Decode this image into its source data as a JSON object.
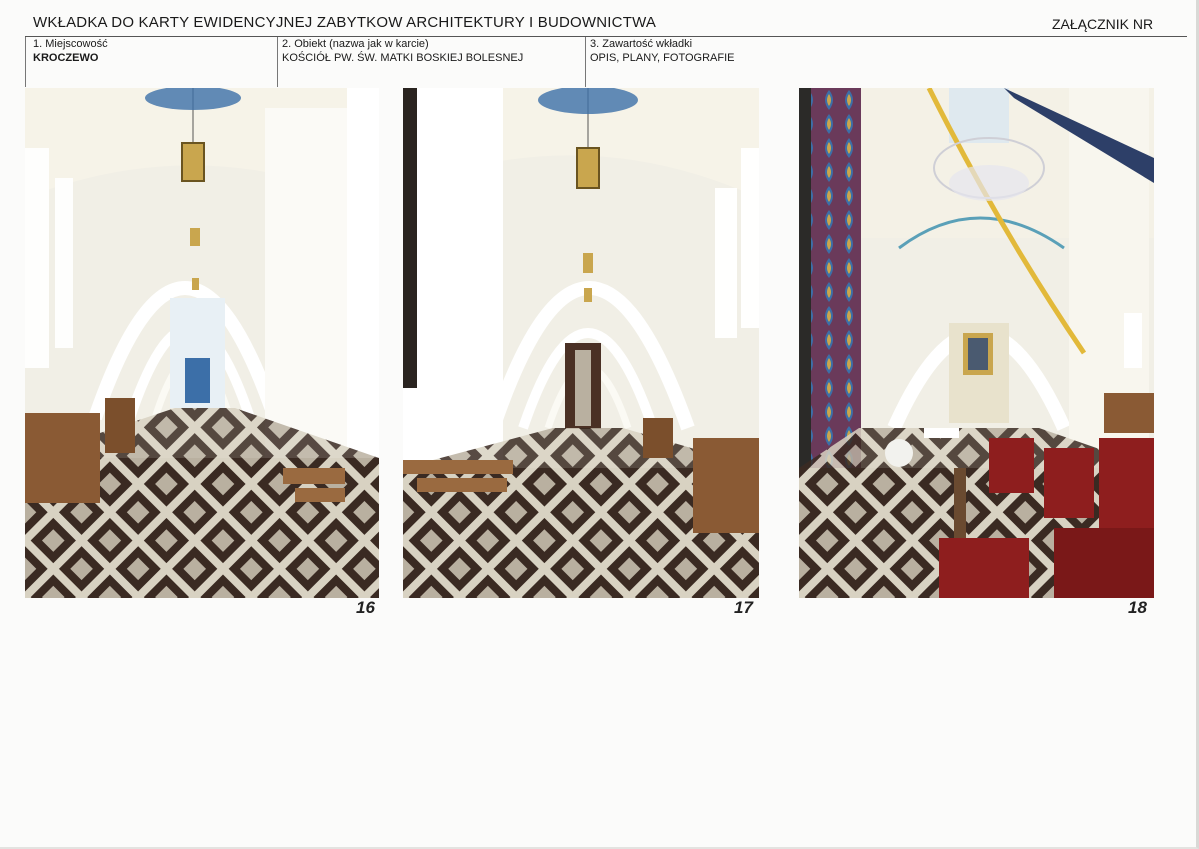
{
  "header": {
    "title": "WKŁADKA DO KARTY EWIDENCYJNEJ ZABYTKOW ARCHITEKTURY I BUDOWNICTWA",
    "annex": "ZAŁĄCZNIK NR"
  },
  "fields": [
    {
      "label": "1. Miejscowość",
      "value": "KROCZEWO"
    },
    {
      "label": "2. Obiekt (nazwa jak w karcie)",
      "value": "KOŚCIÓŁ PW. ŚW. MATKI BOSKIEJ BOLESNEJ"
    },
    {
      "label": "3. Zawartość wkładki",
      "value": "OPIS, PLANY, FOTOGRAFIE"
    }
  ],
  "photos": [
    {
      "number": "16"
    },
    {
      "number": "17"
    },
    {
      "number": "18"
    }
  ],
  "colors": {
    "wall": "#f1efe6",
    "vault": "#f6f3e8",
    "floor_dark": "#3a2a22",
    "floor_light": "#d8d2c2",
    "bench": "#8a5a34",
    "chair_red": "#8e1e1e",
    "paint_blue": "#3c6fa8"
  }
}
